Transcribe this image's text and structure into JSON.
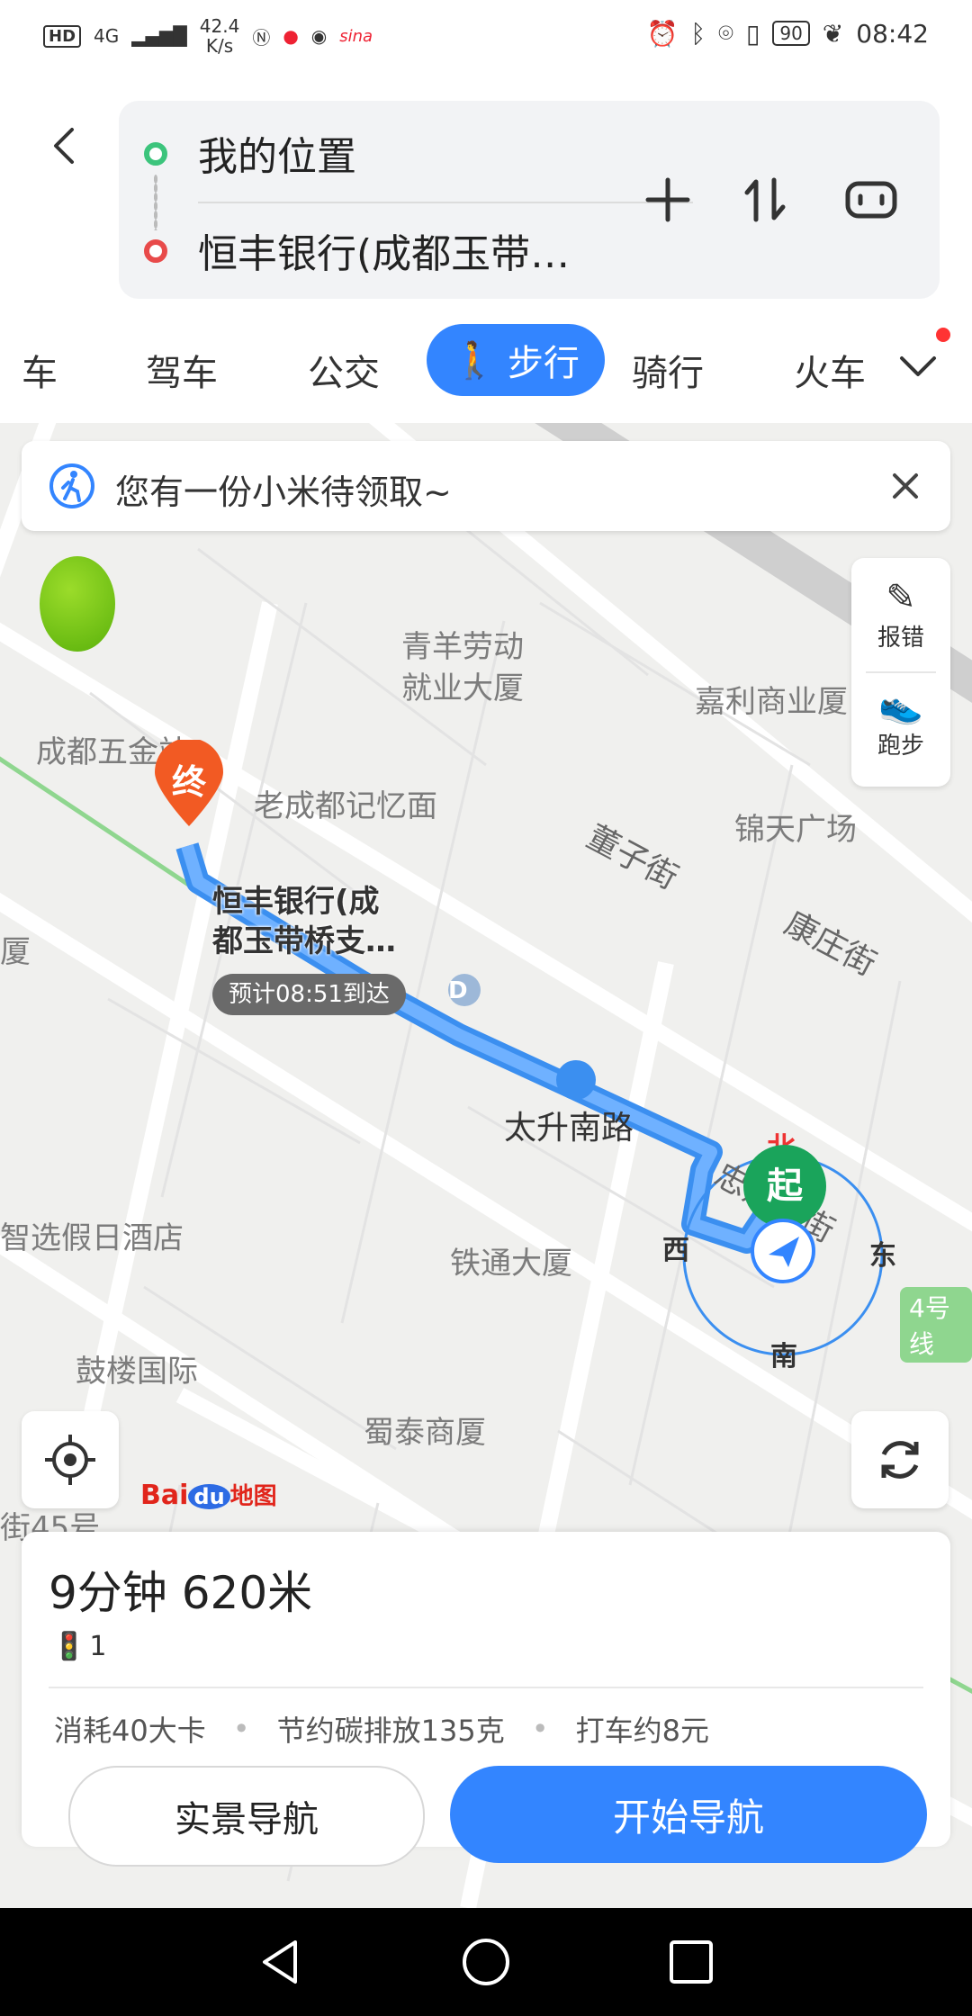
{
  "status_bar": {
    "hd": "HD",
    "network": "4G",
    "speed_value": "42.4",
    "speed_unit": "K/s",
    "app_icon_label": "sina",
    "battery": "90",
    "time": "08:42"
  },
  "route": {
    "from": "我的位置",
    "to": "恒丰银行(成都玉带…"
  },
  "tabs": {
    "car": "车",
    "drive": "驾车",
    "transit": "公交",
    "walk": "步行",
    "ride": "骑行",
    "train": "火车"
  },
  "notice": {
    "text": "您有一份小米待领取~"
  },
  "side_panel": {
    "report": "报错",
    "run": "跑步"
  },
  "map": {
    "pois": {
      "qingyang": "青羊劳动\n就业大厦",
      "jiali": "嘉利商业厦",
      "chengdu_wujin": "成都五金站",
      "laochengdu": "老成都记忆面",
      "jintian": "锦天广场",
      "dongzi": "董子街",
      "kangzhuang": "康庄街",
      "xia": "厦",
      "taisheng": "太升南路",
      "tietong": "铁通大厦",
      "hotel": "智选假日酒店",
      "gulou": "鼓楼国际",
      "shutai": "蜀泰商厦",
      "street45": "街45号",
      "line4": "4号线",
      "zhongfu": "忠烈东街"
    },
    "destination_label": "恒丰银行(成\n都玉带桥支…",
    "eta": "预计08:51到达",
    "end_marker": "终",
    "start_marker": "起",
    "compass": {
      "north": "北",
      "east": "东",
      "south": "南",
      "west": "西"
    },
    "logo_bai": "Bai",
    "logo_du": "du",
    "logo_map": "地图",
    "d_marker": "D"
  },
  "summary": {
    "time_distance": "9分钟  620米",
    "traffic_lights": "1",
    "calories": "消耗40大卡",
    "carbon": "节约碳排放135克",
    "taxi": "打车约8元"
  },
  "buttons": {
    "ar_nav": "实景导航",
    "start_nav": "开始导航"
  }
}
